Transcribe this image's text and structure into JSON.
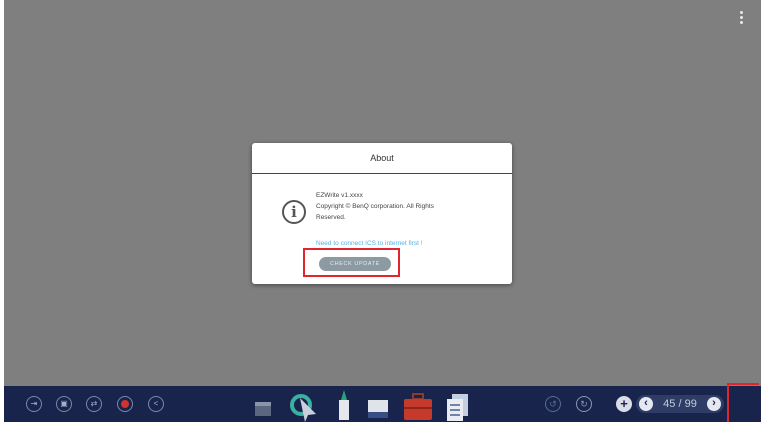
{
  "dialog": {
    "title": "About",
    "app_version": "EZWrite v1.xxxx",
    "copyright_line1": "Copyright © BenQ corporation. All Rights",
    "copyright_line2": "Reserved.",
    "connect_note": "Need to connect ICS to internet first !",
    "check_update_label": "CHECK UPDATE"
  },
  "toolbar": {
    "left_icons": [
      "exit-icon",
      "save-icon",
      "switch-icon",
      "record-icon",
      "share-icon"
    ],
    "tools": [
      "eraser",
      "select-pointer",
      "marker-pen",
      "rectangle",
      "toolbox",
      "documents"
    ],
    "page_indicator": "45 / 99",
    "prev_label": "‹",
    "next_label": "›",
    "add_page_label": "+"
  },
  "colors": {
    "canvas": "#7f7f7f",
    "taskbar": "#19244d",
    "highlight": "#e0252d",
    "link": "#55b0e6",
    "button": "#8c9aa2"
  }
}
